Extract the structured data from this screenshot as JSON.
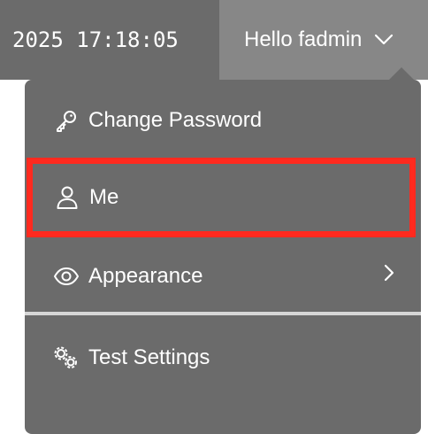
{
  "header": {
    "clock_text": "2025 17:18:05",
    "user_greeting": "Hello fadmin"
  },
  "menu": {
    "items": [
      {
        "label": "Change Password",
        "icon": "key-icon"
      },
      {
        "label": "Me",
        "icon": "person-icon",
        "highlighted": true
      },
      {
        "label": "Appearance",
        "icon": "eye-icon",
        "has_submenu": true
      },
      {
        "label": "Test Settings",
        "icon": "gears-icon"
      }
    ]
  },
  "colors": {
    "bar_background": "#6b6b6b",
    "toggle_background": "#878787",
    "menu_background": "#6b6b6b",
    "highlight_border": "#ff2a1f",
    "divider": "#d6d6d6",
    "text": "#ffffff"
  }
}
